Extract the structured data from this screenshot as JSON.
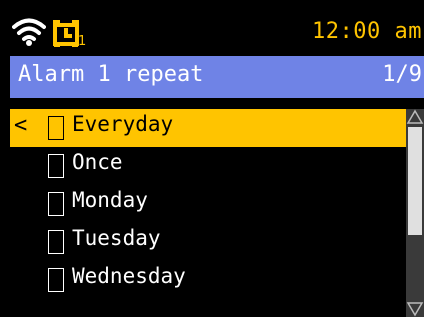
{
  "status_bar": {
    "wifi_icon": "wifi-icon",
    "alarm_icon": "alarm-clock-icon",
    "alarm_number": "1",
    "time": "12:00 am",
    "accent_color": "#ffc400"
  },
  "header": {
    "title": "Alarm 1 repeat",
    "page_indicator": "1/9",
    "background_color": "#6f83e6"
  },
  "list": {
    "back_glyph": "<",
    "items": [
      {
        "label": "Everyday",
        "checked": false,
        "selected": true
      },
      {
        "label": "Once",
        "checked": false,
        "selected": false
      },
      {
        "label": "Monday",
        "checked": false,
        "selected": false
      },
      {
        "label": "Tuesday",
        "checked": false,
        "selected": false
      },
      {
        "label": "Wednesday",
        "checked": false,
        "selected": false
      }
    ]
  },
  "scrollbar": {
    "up_icon": "scroll-up-arrow-icon",
    "down_icon": "scroll-down-arrow-icon"
  }
}
